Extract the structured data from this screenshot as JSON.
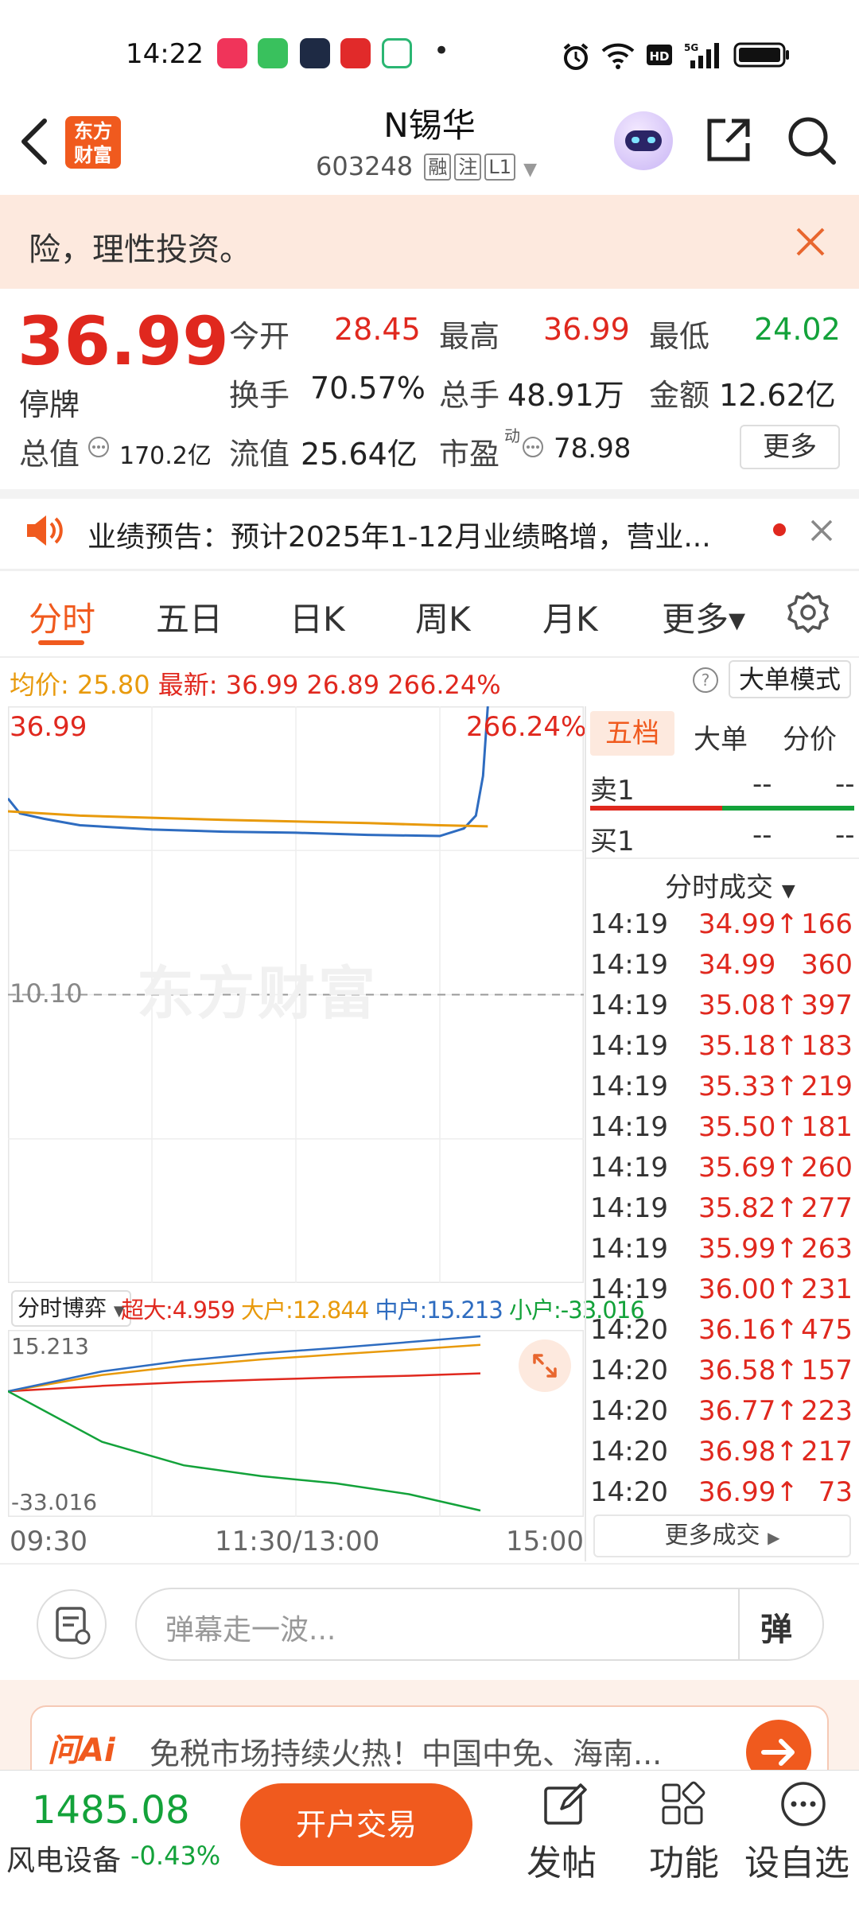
{
  "status_bar": {
    "time": "14:22",
    "dot": "•"
  },
  "header": {
    "logo_line1": "东方",
    "logo_line2": "财富",
    "title": "N锡华",
    "code": "603248",
    "tags": [
      "融",
      "注",
      "L1"
    ]
  },
  "risk_banner": {
    "text": "险，理性投资。"
  },
  "quote": {
    "price": "36.99",
    "status": "停牌",
    "fields": {
      "open_label": "今开",
      "open": "28.45",
      "high_label": "最高",
      "high": "36.99",
      "low_label": "最低",
      "low": "24.02",
      "turnover_label": "换手",
      "turnover": "70.57%",
      "volume_label": "总手",
      "volume": "48.91万",
      "amount_label": "金额",
      "amount": "12.62亿",
      "mktcap_label": "总值",
      "mktcap": "170.2亿",
      "float_label": "流值",
      "float": "25.64亿",
      "pe_label": "市盈",
      "pe_sup": "动",
      "pe": "78.98"
    },
    "more_button": "更多"
  },
  "notice": {
    "text": "业绩预告：预计2025年1-12月业绩略增，营业..."
  },
  "tabs": [
    {
      "label": "分时",
      "active": true
    },
    {
      "label": "五日"
    },
    {
      "label": "日K"
    },
    {
      "label": "周K"
    },
    {
      "label": "月K"
    },
    {
      "label": "更多▾"
    }
  ],
  "chart_header": {
    "avg_label": "均价:",
    "avg": "25.80",
    "latest_label": "最新:",
    "latest": "36.99",
    "change": "26.89",
    "change_pct": "266.24%",
    "mode_button": "大单模式"
  },
  "chart_labels": {
    "price_top": "36.99",
    "pct_top": "266.24%",
    "ref_price": "10.10",
    "watermark": "东方财富",
    "x_ticks": [
      "09:30",
      "11:30/13:00",
      "15:00"
    ]
  },
  "chart_data": [
    {
      "type": "line",
      "title": "",
      "xlabel": "",
      "ylabel": "",
      "x_range": [
        "09:30",
        "15:00"
      ],
      "ylim": [
        -16.79,
        36.99
      ],
      "reference_line": 10.1,
      "series": [
        {
          "name": "最新",
          "x": [
            "09:30",
            "09:35",
            "09:45",
            "10:00",
            "10:30",
            "11:00",
            "11:30",
            "13:30",
            "14:00",
            "14:10",
            "14:15",
            "14:18",
            "14:20"
          ],
          "values": [
            28.4,
            27.0,
            26.5,
            25.9,
            25.5,
            25.3,
            25.2,
            25.0,
            24.9,
            25.6,
            26.8,
            30.5,
            36.99
          ]
        },
        {
          "name": "均价",
          "x": [
            "09:30",
            "10:00",
            "11:00",
            "13:30",
            "14:00",
            "14:20"
          ],
          "values": [
            27.2,
            26.8,
            26.4,
            26.1,
            25.9,
            25.8
          ]
        }
      ]
    },
    {
      "type": "line",
      "title": "",
      "ylim": [
        -33.016,
        15.213
      ],
      "series": [
        {
          "name": "超大",
          "values": [
            0,
            1.5,
            2.5,
            3.2,
            3.8,
            4.3,
            4.959
          ]
        },
        {
          "name": "大户",
          "values": [
            0,
            4.5,
            7.0,
            8.8,
            10.2,
            11.5,
            12.844
          ]
        },
        {
          "name": "中户",
          "values": [
            0,
            5.5,
            8.5,
            10.5,
            12.0,
            13.6,
            15.213
          ]
        },
        {
          "name": "小户",
          "values": [
            0,
            -14.0,
            -20.5,
            -23.5,
            -25.5,
            -28.5,
            -33.016
          ]
        }
      ]
    }
  ],
  "flow_legend": {
    "selector": "分时博弈",
    "items": [
      {
        "label": "超大:",
        "value": "4.959",
        "color": "#e0281e"
      },
      {
        "label": "大户:",
        "value": "12.844",
        "color": "#e89a0c"
      },
      {
        "label": "中户:",
        "value": "15.213",
        "color": "#2e6cc0"
      },
      {
        "label": "小户:",
        "value": "-33.016",
        "color": "#13a23a"
      }
    ],
    "top": "15.213",
    "bottom": "-33.016"
  },
  "side_panel": {
    "tabs": [
      "五档",
      "大单",
      "分价"
    ],
    "sell1_label": "卖1",
    "sell1_price": "--",
    "sell1_vol": "--",
    "buy1_label": "买1",
    "buy1_price": "--",
    "buy1_vol": "--",
    "trades_title": "分时成交",
    "trades": [
      {
        "time": "14:19",
        "price": "34.99↑",
        "vol": "166"
      },
      {
        "time": "14:19",
        "price": "34.99",
        "vol": "360"
      },
      {
        "time": "14:19",
        "price": "35.08↑",
        "vol": "397"
      },
      {
        "time": "14:19",
        "price": "35.18↑",
        "vol": "183"
      },
      {
        "time": "14:19",
        "price": "35.33↑",
        "vol": "219"
      },
      {
        "time": "14:19",
        "price": "35.50↑",
        "vol": "181"
      },
      {
        "time": "14:19",
        "price": "35.69↑",
        "vol": "260"
      },
      {
        "time": "14:19",
        "price": "35.82↑",
        "vol": "277"
      },
      {
        "time": "14:19",
        "price": "35.99↑",
        "vol": "263"
      },
      {
        "time": "14:19",
        "price": "36.00↑",
        "vol": "231"
      },
      {
        "time": "14:20",
        "price": "36.16↑",
        "vol": "475"
      },
      {
        "time": "14:20",
        "price": "36.58↑",
        "vol": "157"
      },
      {
        "time": "14:20",
        "price": "36.77↑",
        "vol": "223"
      },
      {
        "time": "14:20",
        "price": "36.98↑",
        "vol": "217"
      },
      {
        "time": "14:20",
        "price": "36.99↑",
        "vol": "73"
      }
    ],
    "more_trades": "更多成交"
  },
  "comment": {
    "placeholder": "弹幕走一波...",
    "danmu_button": "弹"
  },
  "ai_banner": {
    "logo": "问Ai",
    "text": "免税市场持续火热！中国中免、海南..."
  },
  "bottom_bar": {
    "index_value": "1485.08",
    "index_name": "风电设备",
    "index_change": "-0.43%",
    "trade_button": "开户交易",
    "post": "发帖",
    "functions": "功能",
    "watchlist": "设自选"
  }
}
